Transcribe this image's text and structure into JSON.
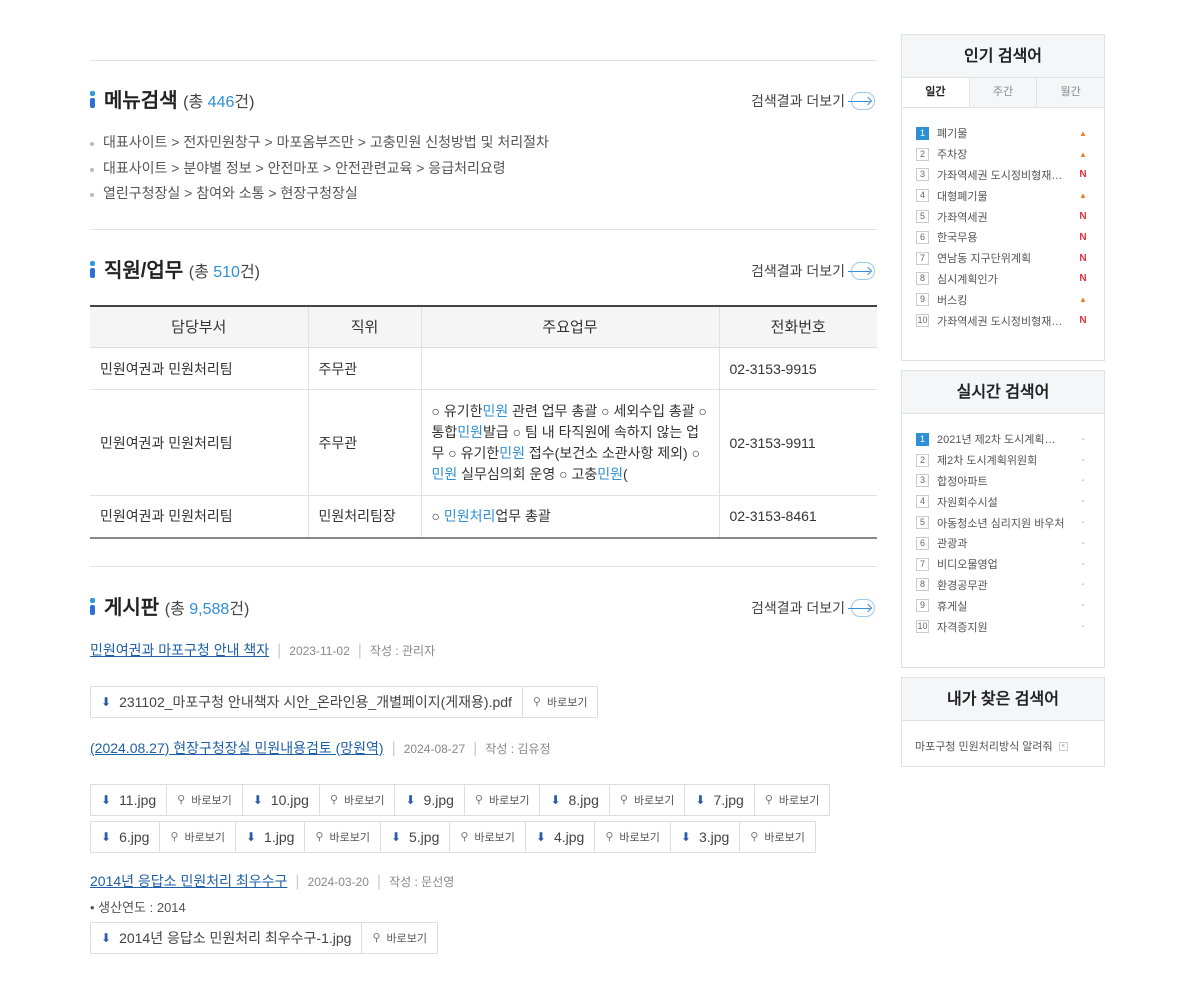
{
  "more_label": "검색결과 더보기",
  "menu": {
    "title": "메뉴검색",
    "count_prefix": "(총 ",
    "count": "446",
    "count_suffix": "건)",
    "items": [
      "대표사이트 > 전자민원창구 > 마포옴부즈만 > 고충민원 신청방법 및 처리절차",
      "대표사이트 > 분야별 정보 > 안전마포 > 안전관련교육 > 응급처리요령",
      "열린구청장실 > 참여와 소통 > 현장구청장실"
    ]
  },
  "staff": {
    "title": "직원/업무",
    "count_prefix": "(총 ",
    "count": "510",
    "count_suffix": "건)",
    "headers": [
      "담당부서",
      "직위",
      "주요업무",
      "전화번호"
    ],
    "rows": [
      {
        "dept": "민원여권과 민원처리팀",
        "position": "주무관",
        "phone": "02-3153-9915"
      },
      {
        "dept": "민원여권과 민원처리팀",
        "position": "주무관",
        "phone": "02-3153-9911"
      },
      {
        "dept": "민원여권과 민원처리팀",
        "position": "민원처리팀장",
        "phone": "02-3153-8461"
      }
    ],
    "work2": {
      "p1": "○ 유기한",
      "h1": "민원",
      "p2": " 관련 업무 총괄 ○ 세외수입 총괄 ○ 통합",
      "h2": "민원",
      "p3": "발급 ○ 팀 내 타직원에 속하지 않는 업무 ○ 유기한",
      "h3": "민원",
      "p4": " 접수(보건소 소관사항 제외) ○ ",
      "h4": "민원",
      "p5": " 실무심의회 운영 ○ 고충",
      "h5": "민원",
      "p6": "("
    },
    "work3": {
      "p1": "○ ",
      "h1": "민원처리",
      "p2": "업무 총괄"
    }
  },
  "board": {
    "title": "게시판",
    "count_prefix": "(총 ",
    "count": "9,588",
    "count_suffix": "건)",
    "view_label": "바로보기",
    "posts": [
      {
        "title": "민원여권과 마포구청 안내 책자",
        "date": "2023-11-02",
        "author": "작성 : 관리자",
        "files": [
          "231102_마포구청 안내책자 시안_온라인용_개별페이지(게재용).pdf"
        ]
      },
      {
        "title": "(2024.08.27) 현장구청장실 민원내용검토 (망원역)",
        "date": "2024-08-27",
        "author": "작성 : 김유정",
        "files_row1": [
          "11.jpg",
          "10.jpg",
          "9.jpg",
          "8.jpg",
          "7.jpg"
        ],
        "files_row2": [
          "6.jpg",
          "1.jpg",
          "5.jpg",
          "4.jpg",
          "3.jpg"
        ]
      },
      {
        "title": "2014년 응답소 민원처리 최우수구",
        "date": "2024-03-20",
        "author": "작성 : 문선영",
        "note": "• 생산연도 : 2014",
        "files": [
          "2014년 응답소 민원처리 최우수구-1.jpg"
        ]
      }
    ]
  },
  "popular": {
    "title": "인기 검색어",
    "tabs": [
      "일간",
      "주간",
      "월간"
    ],
    "items": [
      {
        "rank": "1",
        "text": "폐기물",
        "status": "▲"
      },
      {
        "rank": "2",
        "text": "주차장",
        "status": "▲"
      },
      {
        "rank": "3",
        "text": "가좌역세권 도시정비형재…",
        "status": "N"
      },
      {
        "rank": "4",
        "text": "대형폐기물",
        "status": "▲"
      },
      {
        "rank": "5",
        "text": "가좌역세권",
        "status": "N"
      },
      {
        "rank": "6",
        "text": "한국무용",
        "status": "N"
      },
      {
        "rank": "7",
        "text": "연남동 지구단위계획",
        "status": "N"
      },
      {
        "rank": "8",
        "text": "심시계획인가",
        "status": "N"
      },
      {
        "rank": "9",
        "text": "버스킹",
        "status": "▲"
      },
      {
        "rank": "10",
        "text": "가좌역세권 도시정비형재…",
        "status": "N"
      }
    ]
  },
  "realtime": {
    "title": "실시간 검색어",
    "items": [
      {
        "rank": "1",
        "text": "2021년 제2차 도시계획…",
        "status": "-"
      },
      {
        "rank": "2",
        "text": "제2차 도시계획위원회",
        "status": "-"
      },
      {
        "rank": "3",
        "text": "합정아파트",
        "status": "-"
      },
      {
        "rank": "4",
        "text": "자원회수시설",
        "status": "-"
      },
      {
        "rank": "5",
        "text": "아동청소년 심리지원 바우처",
        "status": "-"
      },
      {
        "rank": "6",
        "text": "관광과",
        "status": "-"
      },
      {
        "rank": "7",
        "text": "비디오물영업",
        "status": "-"
      },
      {
        "rank": "8",
        "text": "환경공무관",
        "status": "-"
      },
      {
        "rank": "9",
        "text": "휴게실",
        "status": "-"
      },
      {
        "rank": "10",
        "text": "자격증지원",
        "status": "-"
      }
    ]
  },
  "mine": {
    "title": "내가 찾은 검색어",
    "items": [
      {
        "text": "마포구청 민원처리방식 알려줘",
        "remove": "×"
      }
    ]
  }
}
